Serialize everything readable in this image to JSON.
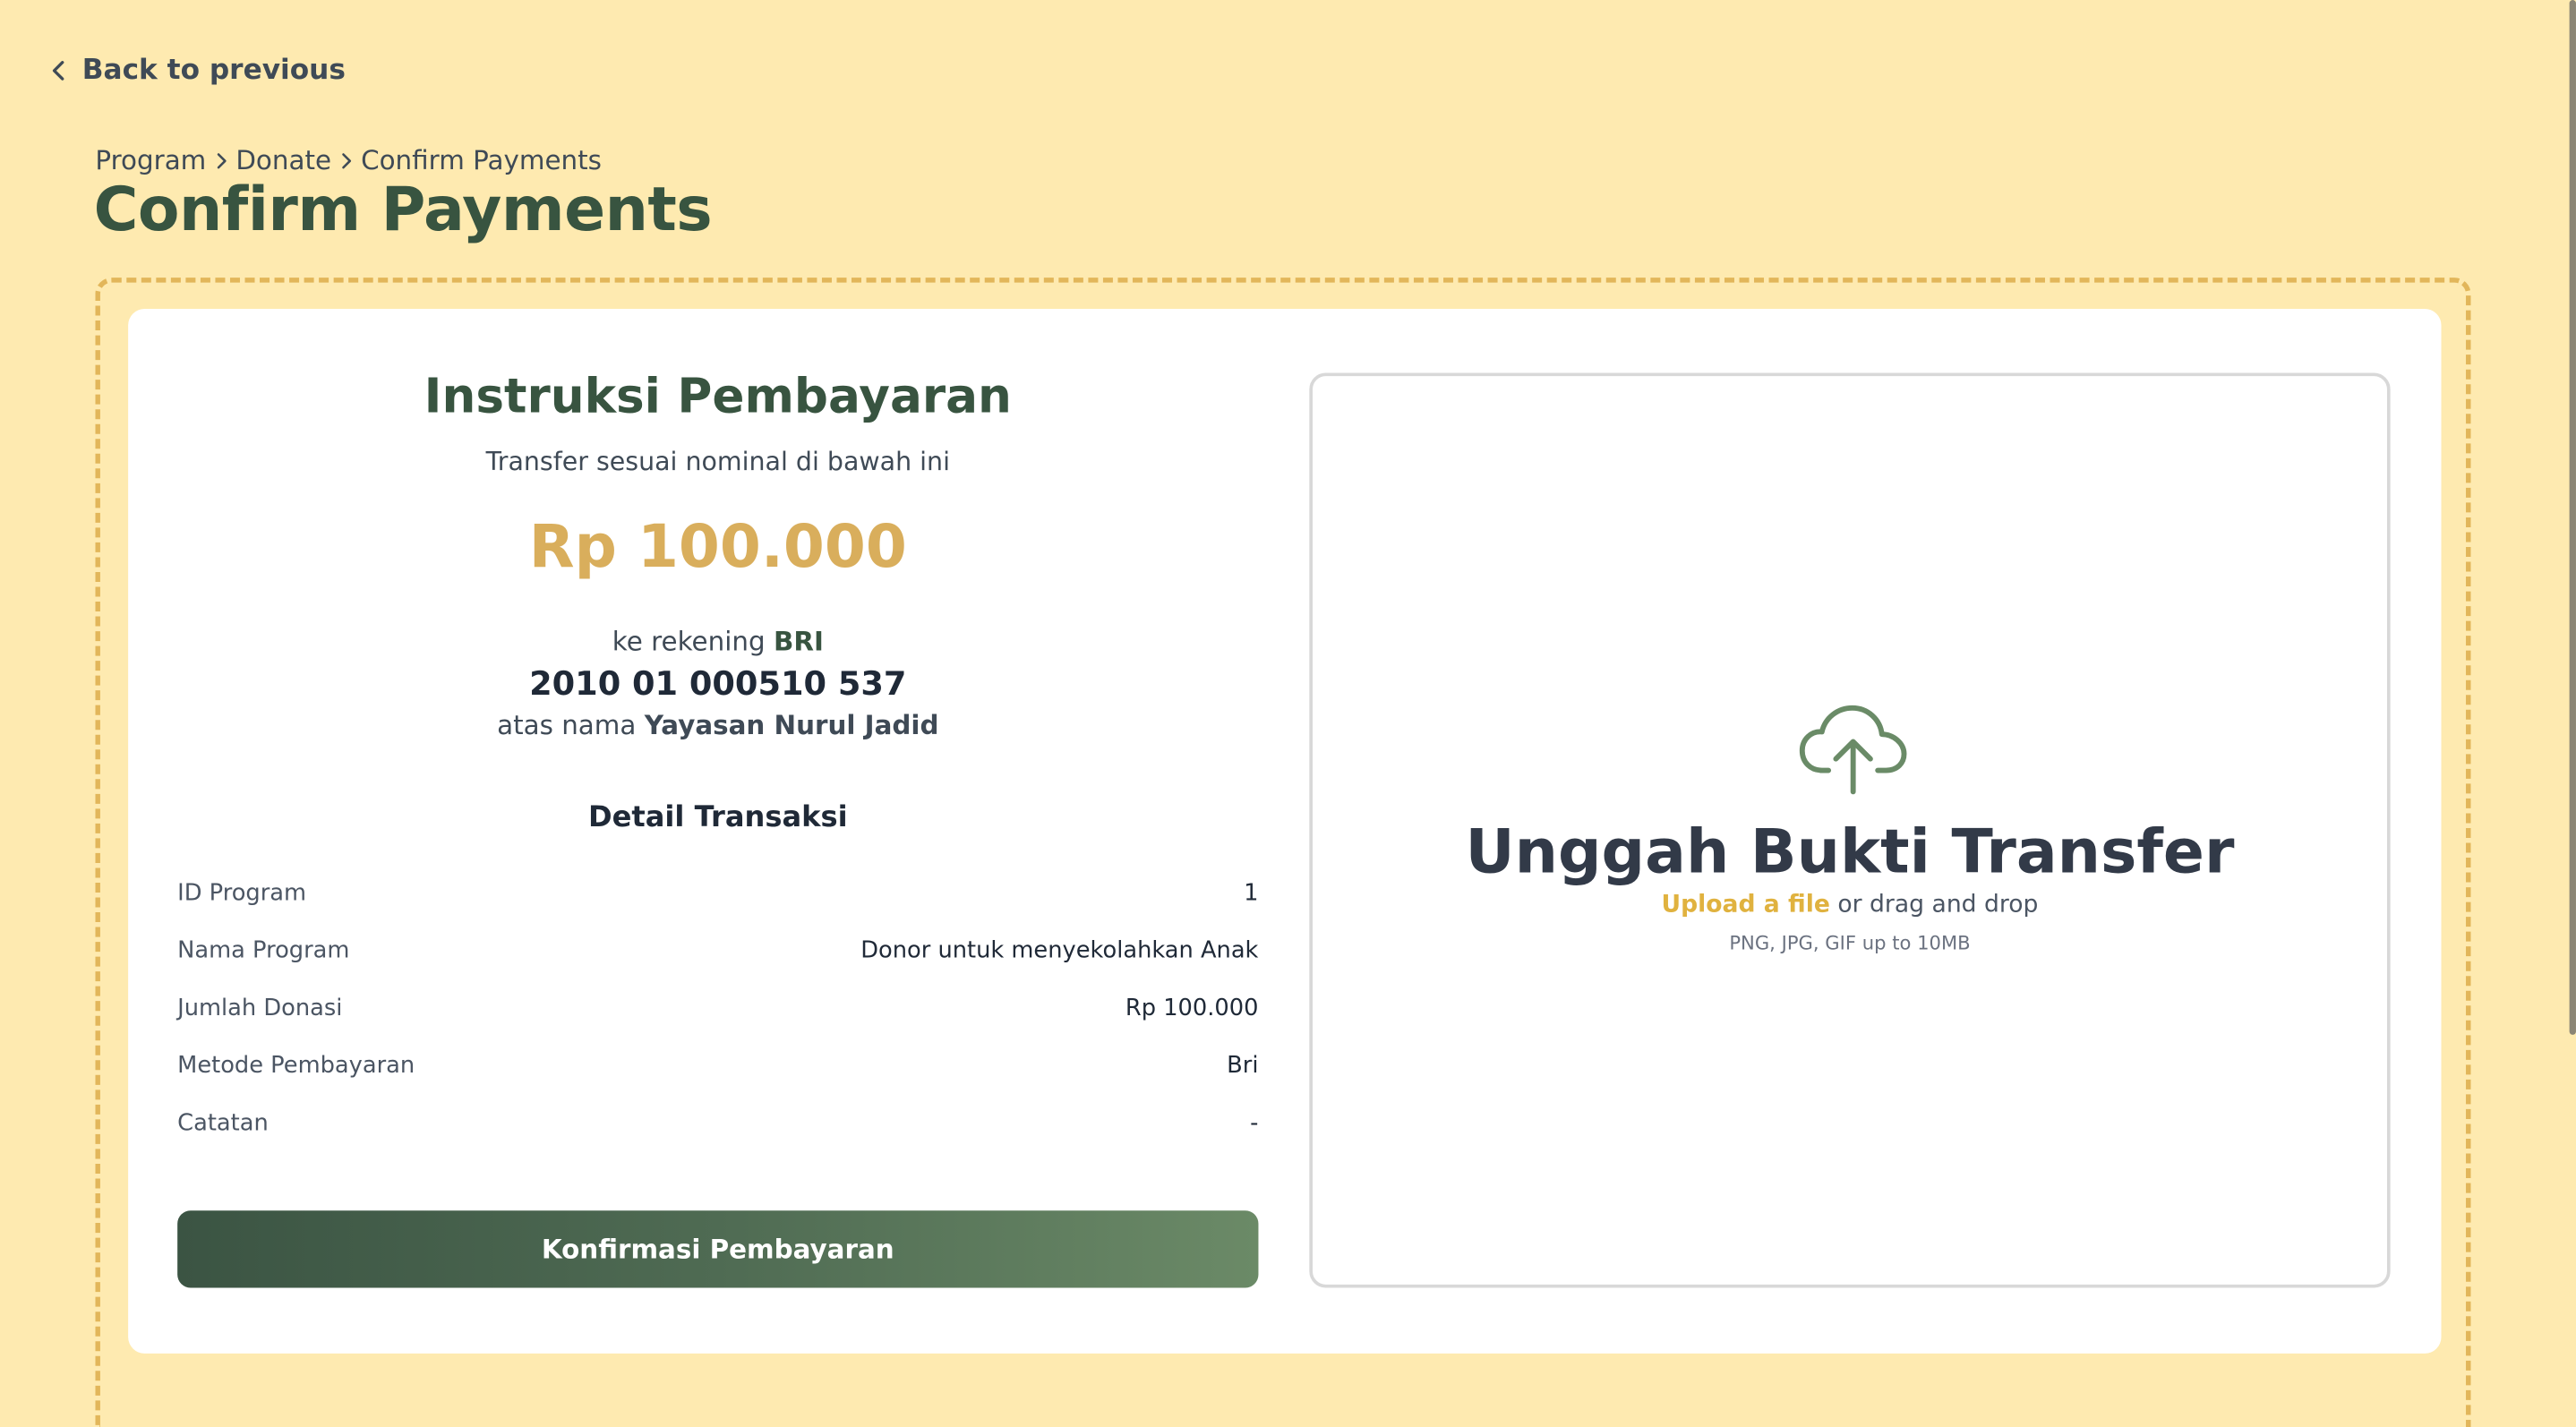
{
  "nav": {
    "back_label": "Back to previous"
  },
  "breadcrumb": {
    "items": [
      "Program",
      "Donate",
      "Confirm Payments"
    ]
  },
  "page": {
    "title": "Confirm Payments"
  },
  "instructions": {
    "title": "Instruksi Pembayaran",
    "subtitle": "Transfer sesuai nominal di bawah ini",
    "amount": "Rp 100.000",
    "bank_prefix": "ke rekening",
    "bank_name": "BRI",
    "account_number": "2010 01 000510 537",
    "holder_prefix": "atas nama",
    "holder_name": "Yayasan Nurul Jadid"
  },
  "details": {
    "title": "Detail Transaksi",
    "rows": [
      {
        "label": "ID Program",
        "value": "1"
      },
      {
        "label": "Nama Program",
        "value": "Donor untuk menyekolahkan Anak"
      },
      {
        "label": "Jumlah Donasi",
        "value": "Rp 100.000"
      },
      {
        "label": "Metode Pembayaran",
        "value": "Bri"
      },
      {
        "label": "Catatan",
        "value": "-"
      }
    ]
  },
  "actions": {
    "confirm_label": "Konfirmasi Pembayaran"
  },
  "upload": {
    "title": "Unggah Bukti Transfer",
    "link_label": "Upload a file",
    "hint_suffix": " or drag and drop",
    "formats": "PNG, JPG, GIF up to 10MB",
    "icon": "cloud-upload-icon"
  },
  "colors": {
    "background": "#FEEAB0",
    "brand_green": "#385440",
    "accent_gold": "#D9AE5C",
    "dashed_border": "#E2B65A"
  }
}
